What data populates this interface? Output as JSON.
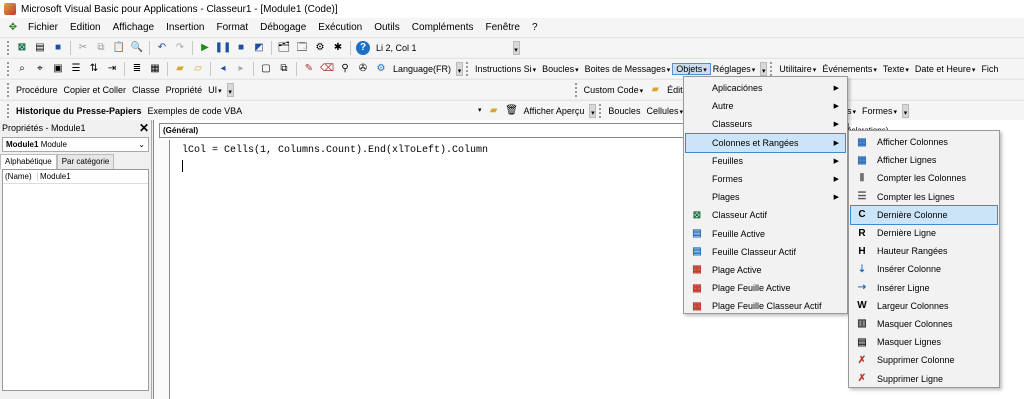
{
  "window": {
    "title": "Microsoft Visual Basic pour Applications - Classeur1 - [Module1 (Code)]"
  },
  "menubar": [
    "Fichier",
    "Edition",
    "Affichage",
    "Insertion",
    "Format",
    "Débogage",
    "Exécution",
    "Outils",
    "Compléments",
    "Fenêtre",
    "?"
  ],
  "toolbar1": {
    "position": "Li 2, Col 1"
  },
  "toolbar2": {
    "language": "Language(FR)",
    "items": [
      "Instructions Si",
      "Boucles",
      "Boites de Messages",
      "Objets",
      "Réglages",
      "Utilitaire",
      "Événements",
      "Texte",
      "Date et Heure",
      "Fich"
    ]
  },
  "toolbar3": {
    "items": [
      "Procédure",
      "Copier et Coller",
      "Classe",
      "Propriété",
      "UI"
    ],
    "right_items": [
      "Custom Code",
      "Édit"
    ]
  },
  "toolbar4": {
    "history_label": "Historique du Presse-Papiers",
    "history_value": "Exemples de code VBA",
    "preview": "Afficher Aperçu",
    "items": [
      "Boucles",
      "Cellules"
    ],
    "right_items": [
      "urs",
      "Formes"
    ]
  },
  "properties": {
    "title": "Propriétés - Module1",
    "combo_name": "Module1",
    "combo_type": "Module",
    "tabs": [
      "Alphabétique",
      "Par catégorie"
    ],
    "rows": [
      {
        "key": "(Name)",
        "value": "Module1"
      }
    ]
  },
  "editor": {
    "object_combo": "(Général)",
    "proc_combo": "éclarations)",
    "code_line": "lCol = Cells(1, Columns.Count).End(xlToLeft).Column"
  },
  "objets_menu": [
    {
      "label": "Aplicaciónes",
      "submenu": true,
      "icon": ""
    },
    {
      "label": "Autre",
      "submenu": true,
      "icon": ""
    },
    {
      "label": "Classeurs",
      "submenu": true,
      "icon": ""
    },
    {
      "label": "Colonnes et Rangées",
      "submenu": true,
      "icon": "",
      "highlighted": true
    },
    {
      "label": "Feuilles",
      "submenu": true,
      "icon": ""
    },
    {
      "label": "Formes",
      "submenu": true,
      "icon": ""
    },
    {
      "label": "Plages",
      "submenu": true,
      "icon": ""
    },
    {
      "label": "Classeur Actif",
      "submenu": false,
      "icon": "excel-icon"
    },
    {
      "label": "Feuille Active",
      "submenu": false,
      "icon": "sheet-icon"
    },
    {
      "label": "Feuille Classeur Actif",
      "submenu": false,
      "icon": "sheet-icon"
    },
    {
      "label": "Plage Active",
      "submenu": false,
      "icon": "range-icon"
    },
    {
      "label": "Plage Feuille Active",
      "submenu": false,
      "icon": "range-icon"
    },
    {
      "label": "Plage Feuille Classeur Actif",
      "submenu": false,
      "icon": "range-icon"
    }
  ],
  "colonnes_submenu": [
    {
      "label": "Afficher Colonnes",
      "icon": "grid-icon",
      "glyph": ""
    },
    {
      "label": "Afficher Lignes",
      "icon": "grid-icon",
      "glyph": ""
    },
    {
      "label": "Compter les Colonnes",
      "icon": "columns-icon",
      "glyph": ""
    },
    {
      "label": "Compter les Lignes",
      "icon": "rows-icon",
      "glyph": ""
    },
    {
      "label": "Dernière Colonne",
      "icon": "letter-c-icon",
      "glyph": "C",
      "highlighted": true
    },
    {
      "label": "Dernière Ligne",
      "icon": "letter-r-icon",
      "glyph": "R"
    },
    {
      "label": "Hauteur Rangées",
      "icon": "letter-h-icon",
      "glyph": "H"
    },
    {
      "label": "Insérer Colonne",
      "icon": "insert-column-icon",
      "glyph": ""
    },
    {
      "label": "Insérer Ligne",
      "icon": "insert-row-icon",
      "glyph": ""
    },
    {
      "label": "Largeur Colonnes",
      "icon": "letter-w-icon",
      "glyph": "W"
    },
    {
      "label": "Masquer Colonnes",
      "icon": "hide-columns-icon",
      "glyph": ""
    },
    {
      "label": "Masquer Lignes",
      "icon": "hide-rows-icon",
      "glyph": ""
    },
    {
      "label": "Supprimer Colonne",
      "icon": "delete-column-icon",
      "glyph": ""
    },
    {
      "label": "Supprimer Ligne",
      "icon": "delete-row-icon",
      "glyph": ""
    }
  ],
  "colors": {
    "highlight_bg": "#cce4f7",
    "highlight_border": "#3c8bd0",
    "menu_bg": "#f2f2f2"
  }
}
